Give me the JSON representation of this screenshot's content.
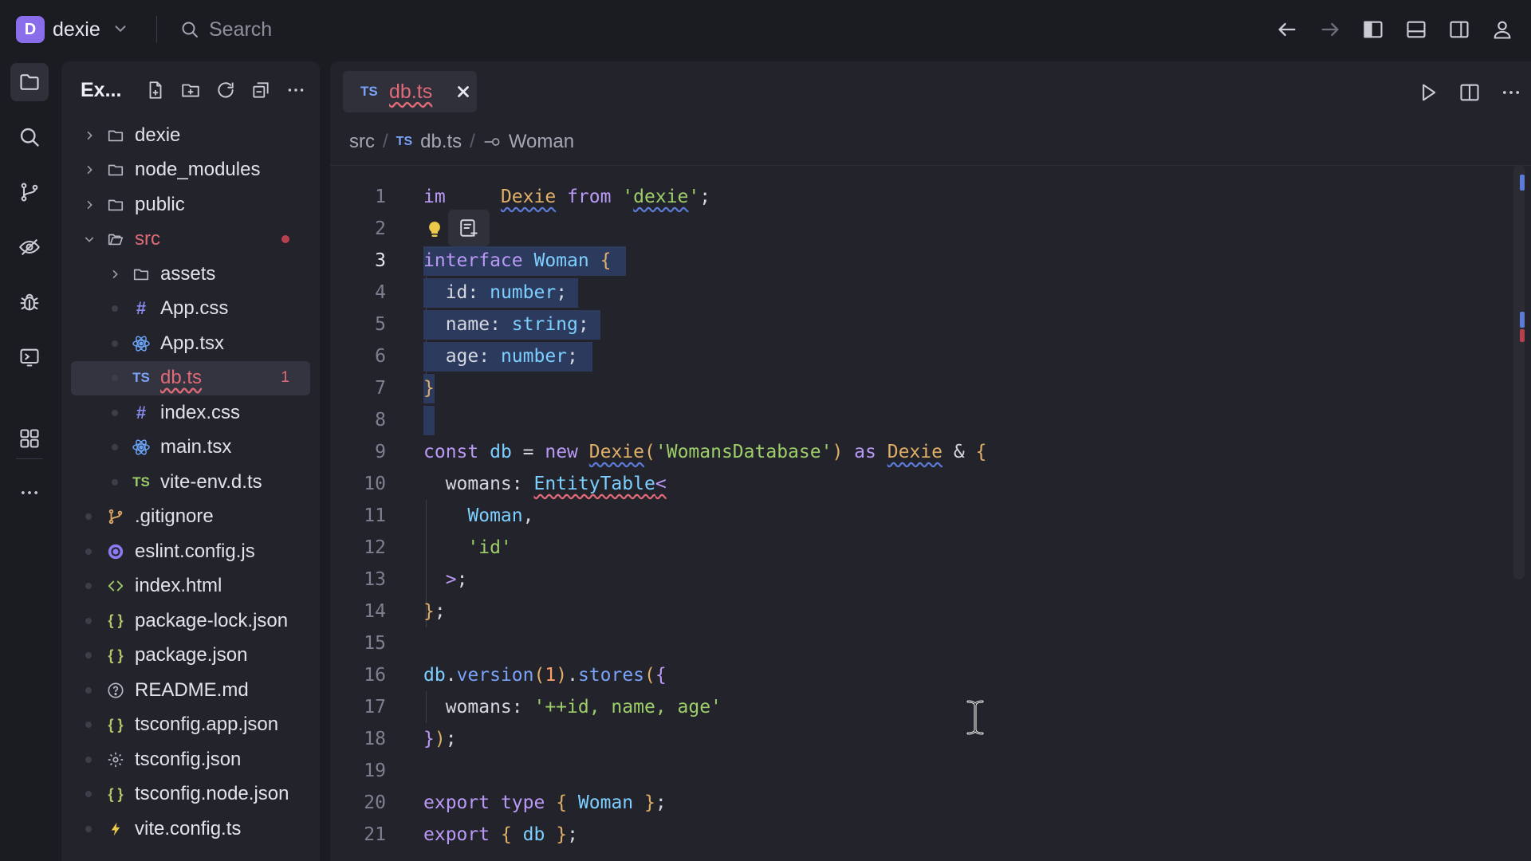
{
  "titlebar": {
    "workspace_initial": "D",
    "workspace_name": "dexie",
    "search_placeholder": "Search"
  },
  "sidebar": {
    "title": "Ex...",
    "items": [
      {
        "name": "dexie",
        "type": "folder",
        "level": 0,
        "expanded": false
      },
      {
        "name": "node_modules",
        "type": "folder",
        "level": 0,
        "expanded": false
      },
      {
        "name": "public",
        "type": "folder",
        "level": 0,
        "expanded": false
      },
      {
        "name": "src",
        "type": "folder",
        "level": 0,
        "expanded": true,
        "status": "error"
      },
      {
        "name": "assets",
        "type": "folder",
        "level": 1,
        "expanded": false
      },
      {
        "name": "App.css",
        "type": "css",
        "level": 1
      },
      {
        "name": "App.tsx",
        "type": "react",
        "level": 1
      },
      {
        "name": "db.ts",
        "type": "ts",
        "level": 1,
        "selected": true,
        "error_count": "1"
      },
      {
        "name": "index.css",
        "type": "css",
        "level": 1
      },
      {
        "name": "main.tsx",
        "type": "react",
        "level": 1
      },
      {
        "name": "vite-env.d.ts",
        "type": "ts-green",
        "level": 1
      },
      {
        "name": ".gitignore",
        "type": "git",
        "level": 0
      },
      {
        "name": "eslint.config.js",
        "type": "eslint",
        "level": 0
      },
      {
        "name": "index.html",
        "type": "html",
        "level": 0
      },
      {
        "name": "package-lock.json",
        "type": "json",
        "level": 0
      },
      {
        "name": "package.json",
        "type": "json",
        "level": 0
      },
      {
        "name": "README.md",
        "type": "info",
        "level": 0
      },
      {
        "name": "tsconfig.app.json",
        "type": "json",
        "level": 0
      },
      {
        "name": "tsconfig.json",
        "type": "gear",
        "level": 0
      },
      {
        "name": "tsconfig.node.json",
        "type": "json",
        "level": 0
      },
      {
        "name": "vite.config.ts",
        "type": "vite",
        "level": 0
      }
    ]
  },
  "editor": {
    "tab": {
      "icon_text": "TS",
      "name": "db.ts"
    },
    "breadcrumb": {
      "folder": "src",
      "icon_text": "TS",
      "file": "db.ts",
      "symbol": "Woman"
    },
    "current_line": 3,
    "lines": [
      {
        "n": "1",
        "tokens": [
          [
            "k",
            "im"
          ],
          [
            "",
            "  "
          ],
          [
            "",
            "   "
          ],
          [
            "cl wavy-b",
            "Dexie"
          ],
          [
            "",
            " "
          ],
          [
            "k",
            "from"
          ],
          [
            "",
            " "
          ],
          [
            "s",
            "'"
          ],
          [
            "s wavy-b",
            "dexie"
          ],
          [
            "s",
            "'"
          ],
          [
            "",
            ";"
          ]
        ]
      },
      {
        "n": "2",
        "tokens": []
      },
      {
        "n": "3",
        "tokens": [
          [
            "k",
            "interface"
          ],
          [
            "",
            " "
          ],
          [
            "t",
            "Woman"
          ],
          [
            "",
            " "
          ],
          [
            "p",
            "{"
          ]
        ]
      },
      {
        "n": "4",
        "tokens": [
          [
            "",
            "  id: "
          ],
          [
            "ty",
            "number"
          ],
          [
            "",
            ";"
          ]
        ]
      },
      {
        "n": "5",
        "tokens": [
          [
            "",
            "  name: "
          ],
          [
            "ty",
            "string"
          ],
          [
            "",
            ";"
          ]
        ]
      },
      {
        "n": "6",
        "tokens": [
          [
            "",
            "  age: "
          ],
          [
            "ty",
            "number"
          ],
          [
            "",
            ";"
          ]
        ]
      },
      {
        "n": "7",
        "tokens": [
          [
            "p",
            "}"
          ]
        ]
      },
      {
        "n": "8",
        "tokens": []
      },
      {
        "n": "9",
        "tokens": [
          [
            "k",
            "const"
          ],
          [
            "",
            " "
          ],
          [
            "v",
            "db"
          ],
          [
            "",
            " = "
          ],
          [
            "k",
            "new"
          ],
          [
            "",
            " "
          ],
          [
            "cl wavy-b",
            "Dexie"
          ],
          [
            "p",
            "("
          ],
          [
            "s",
            "'WomansDatabase'"
          ],
          [
            "p",
            ")"
          ],
          [
            "",
            " "
          ],
          [
            "k",
            "as"
          ],
          [
            "",
            " "
          ],
          [
            "cl wavy-b",
            "Dexie"
          ],
          [
            "",
            " & "
          ],
          [
            "p",
            "{"
          ]
        ]
      },
      {
        "n": "10",
        "tokens": [
          [
            "",
            "  womans: "
          ],
          [
            "t wavy-r",
            "EntityTable"
          ],
          [
            "pp wavy-r",
            "<"
          ]
        ]
      },
      {
        "n": "11",
        "tokens": [
          [
            "",
            "    "
          ],
          [
            "t",
            "Woman"
          ],
          [
            "",
            ","
          ]
        ]
      },
      {
        "n": "12",
        "tokens": [
          [
            "",
            "    "
          ],
          [
            "s",
            "'id'"
          ]
        ]
      },
      {
        "n": "13",
        "tokens": [
          [
            "",
            "  "
          ],
          [
            "pp",
            ">"
          ],
          [
            "",
            ";"
          ]
        ]
      },
      {
        "n": "14",
        "tokens": [
          [
            "p",
            "}"
          ],
          [
            "",
            ";"
          ]
        ]
      },
      {
        "n": "15",
        "tokens": []
      },
      {
        "n": "16",
        "tokens": [
          [
            "v",
            "db"
          ],
          [
            "",
            "."
          ],
          [
            "f",
            "version"
          ],
          [
            "p",
            "("
          ],
          [
            "n",
            "1"
          ],
          [
            "p",
            ")"
          ],
          [
            "",
            "."
          ],
          [
            "f",
            "stores"
          ],
          [
            "p",
            "("
          ],
          [
            "pp",
            "{"
          ]
        ]
      },
      {
        "n": "17",
        "tokens": [
          [
            "",
            "  womans: "
          ],
          [
            "s",
            "'++id, name, age'"
          ]
        ]
      },
      {
        "n": "18",
        "tokens": [
          [
            "pp",
            "}"
          ],
          [
            "p",
            ")"
          ],
          [
            "",
            ";"
          ]
        ]
      },
      {
        "n": "19",
        "tokens": []
      },
      {
        "n": "20",
        "tokens": [
          [
            "k",
            "export"
          ],
          [
            "",
            " "
          ],
          [
            "k",
            "type"
          ],
          [
            "",
            " "
          ],
          [
            "p",
            "{"
          ],
          [
            "",
            " "
          ],
          [
            "t",
            "Woman"
          ],
          [
            "",
            " "
          ],
          [
            "p",
            "}"
          ],
          [
            "",
            ";"
          ]
        ]
      },
      {
        "n": "21",
        "tokens": [
          [
            "k",
            "export"
          ],
          [
            "",
            " "
          ],
          [
            "p",
            "{"
          ],
          [
            "",
            " "
          ],
          [
            "v",
            "db"
          ],
          [
            "",
            " "
          ],
          [
            "p",
            "}"
          ],
          [
            "",
            ";"
          ]
        ]
      }
    ]
  },
  "icons": {
    "chevron": "chevron-down-icon",
    "search": "search-icon",
    "back": "arrow-left-icon",
    "forward": "arrow-right-icon",
    "toggle_left_panel": "panel-left-icon",
    "toggle_bottom_panel": "panel-bottom-icon",
    "toggle_right_panel": "panel-right-icon",
    "account": "user-icon",
    "run": "play-icon",
    "split": "split-editor-icon",
    "more": "more-icon"
  },
  "colors": {
    "accent": "#8a6dea",
    "error": "#e06a78",
    "selection": "#2c3a5e"
  }
}
